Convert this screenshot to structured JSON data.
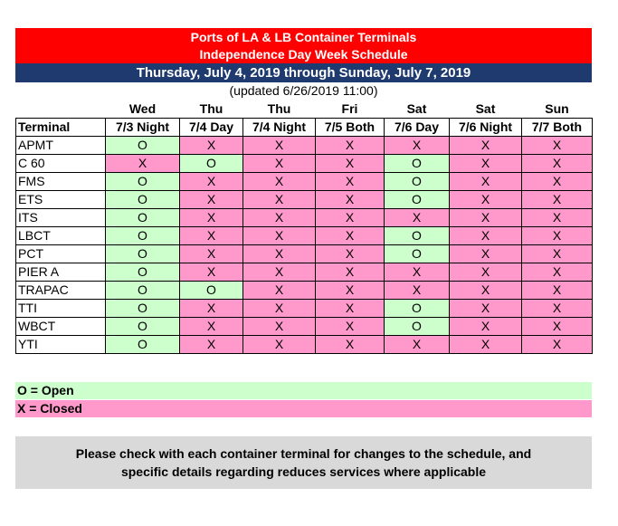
{
  "header": {
    "title_line1": "Ports of LA & LB Container Terminals",
    "title_line2": "Independence Day Week Schedule",
    "date_range": "Thursday, July 4, 2019 through Sunday, July 7, 2019",
    "updated": "(updated 6/26/2019 11:00)"
  },
  "colors": {
    "title_bg": "#ff0000",
    "date_bg": "#1f3a6e",
    "open_bg": "#ccffcc",
    "closed_bg": "#ff99cc",
    "note_bg": "#d9d9d9"
  },
  "table": {
    "days": [
      "",
      "Wed",
      "Thu",
      "Thu",
      "Fri",
      "Sat",
      "Sat",
      "Sun"
    ],
    "headers": [
      "Terminal",
      "7/3 Night",
      "7/4 Day",
      "7/4 Night",
      "7/5 Both",
      "7/6 Day",
      "7/6 Night",
      "7/7 Both"
    ],
    "rows": [
      {
        "terminal": "APMT",
        "cells": [
          "O",
          "X",
          "X",
          "X",
          "X",
          "X",
          "X"
        ]
      },
      {
        "terminal": "C 60",
        "cells": [
          "X",
          "O",
          "X",
          "X",
          "O",
          "X",
          "X"
        ]
      },
      {
        "terminal": "FMS",
        "cells": [
          "O",
          "X",
          "X",
          "X",
          "O",
          "X",
          "X"
        ]
      },
      {
        "terminal": "ETS",
        "cells": [
          "O",
          "X",
          "X",
          "X",
          "O",
          "X",
          "X"
        ]
      },
      {
        "terminal": "ITS",
        "cells": [
          "O",
          "X",
          "X",
          "X",
          "X",
          "X",
          "X"
        ]
      },
      {
        "terminal": "LBCT",
        "cells": [
          "O",
          "X",
          "X",
          "X",
          "O",
          "X",
          "X"
        ]
      },
      {
        "terminal": "PCT",
        "cells": [
          "O",
          "X",
          "X",
          "X",
          "O",
          "X",
          "X"
        ]
      },
      {
        "terminal": "PIER A",
        "cells": [
          "O",
          "X",
          "X",
          "X",
          "X",
          "X",
          "X"
        ]
      },
      {
        "terminal": "TRAPAC",
        "cells": [
          "O",
          "O",
          "X",
          "X",
          "X",
          "X",
          "X"
        ]
      },
      {
        "terminal": "TTI",
        "cells": [
          "O",
          "X",
          "X",
          "X",
          "O",
          "X",
          "X"
        ]
      },
      {
        "terminal": "WBCT",
        "cells": [
          "O",
          "X",
          "X",
          "X",
          "O",
          "X",
          "X"
        ]
      },
      {
        "terminal": "YTI",
        "cells": [
          "O",
          "X",
          "X",
          "X",
          "X",
          "X",
          "X"
        ]
      }
    ]
  },
  "legend": {
    "open": "O = Open",
    "closed": "X = Closed"
  },
  "note": {
    "line1": "Please check with each container terminal for changes to the schedule, and",
    "line2": "specific details regarding reduces services where applicable"
  }
}
